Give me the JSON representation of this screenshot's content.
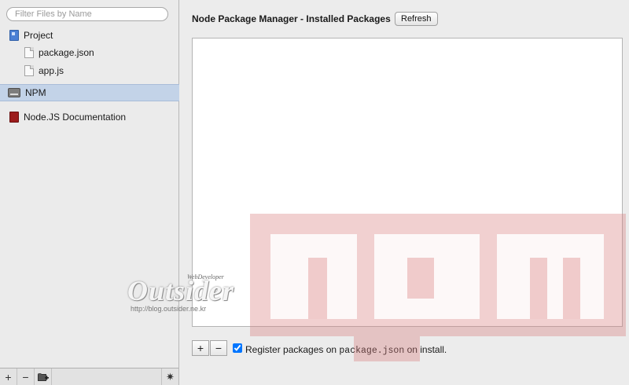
{
  "sidebar": {
    "filter_placeholder": "Filter Files by Name",
    "items": [
      {
        "label": "Project",
        "icon": "project-icon"
      },
      {
        "label": "package.json",
        "icon": "file-icon"
      },
      {
        "label": "app.js",
        "icon": "file-icon"
      },
      {
        "label": "NPM",
        "icon": "npm-icon",
        "selected": true
      },
      {
        "label": "Node.JS Documentation",
        "icon": "book-icon"
      }
    ],
    "bottom_buttons": {
      "add": "+",
      "remove": "−",
      "add_folder": "add-folder-icon",
      "settings": "✷"
    }
  },
  "main": {
    "title": "Node Package Manager - Installed Packages",
    "refresh_label": "Refresh",
    "add_label": "+",
    "remove_label": "−",
    "register_checked": true,
    "register_prefix": "Register packages on ",
    "register_code": "package.json",
    "register_suffix": " on install."
  },
  "watermark": {
    "npm_text": "npm",
    "site_tag": "WebDeveloper",
    "site_name": "Outsider",
    "site_url": "http://blog.outsider.ne.kr"
  },
  "colors": {
    "selection": "#c3d3e8",
    "npm_watermark": "#e0a6a6"
  }
}
